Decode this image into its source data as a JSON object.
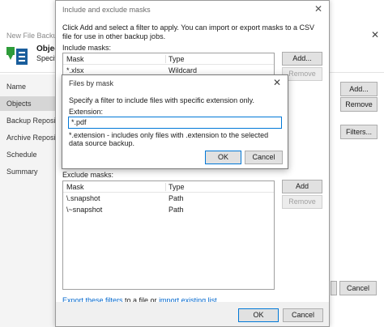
{
  "background_window": {
    "title": "New File Backup Job",
    "close_glyph": "✕",
    "header_title": "Objects",
    "header_subtitle": "Specify",
    "nav": [
      {
        "label": "Name",
        "active": false
      },
      {
        "label": "Objects",
        "active": true
      },
      {
        "label": "Backup Repository",
        "active": false
      },
      {
        "label": "Archive Repository",
        "active": false
      },
      {
        "label": "Schedule",
        "active": false
      },
      {
        "label": "Summary",
        "active": false
      }
    ],
    "buttons": {
      "add": "Add...",
      "remove": "Remove",
      "filters": "Filters...",
      "cancel": "Cancel"
    }
  },
  "mask_dialog": {
    "title": "Include and exclude masks",
    "close_glyph": "✕",
    "description": "Click Add and select a filter to apply. You can import or export masks to a CSV file for use in other backup jobs.",
    "include": {
      "label": "Include masks:",
      "columns": [
        "Mask",
        "Type"
      ],
      "rows": [
        {
          "mask": "*.xlsx",
          "type": "Wildcard"
        }
      ],
      "add_label": "Add...",
      "remove_label": "Remove"
    },
    "exclude": {
      "label": "Exclude masks:",
      "columns": [
        "Mask",
        "Type"
      ],
      "rows": [
        {
          "mask": "\\.snapshot",
          "type": "Path"
        },
        {
          "mask": "\\~snapshot",
          "type": "Path"
        }
      ],
      "add_label": "Add",
      "remove_label": "Remove"
    },
    "links": {
      "export_text": "Export these filters",
      "middle_text": " to a file or ",
      "import_text": "import existing list"
    },
    "ok_label": "OK",
    "cancel_label": "Cancel"
  },
  "files_by_mask": {
    "title": "Files by mask",
    "close_glyph": "✕",
    "description": "Specify a filter to include files with specific extension only.",
    "extension_label": "Extension:",
    "extension_value": "*.pdf",
    "hint": "*.extension - includes only files with .extension to the selected data source backup.",
    "ok_label": "OK",
    "cancel_label": "Cancel"
  },
  "colors": {
    "accent": "#0078d7",
    "link": "#0066cc",
    "icon_green": "#2e9c3a",
    "icon_blue": "#1a5e9c"
  }
}
